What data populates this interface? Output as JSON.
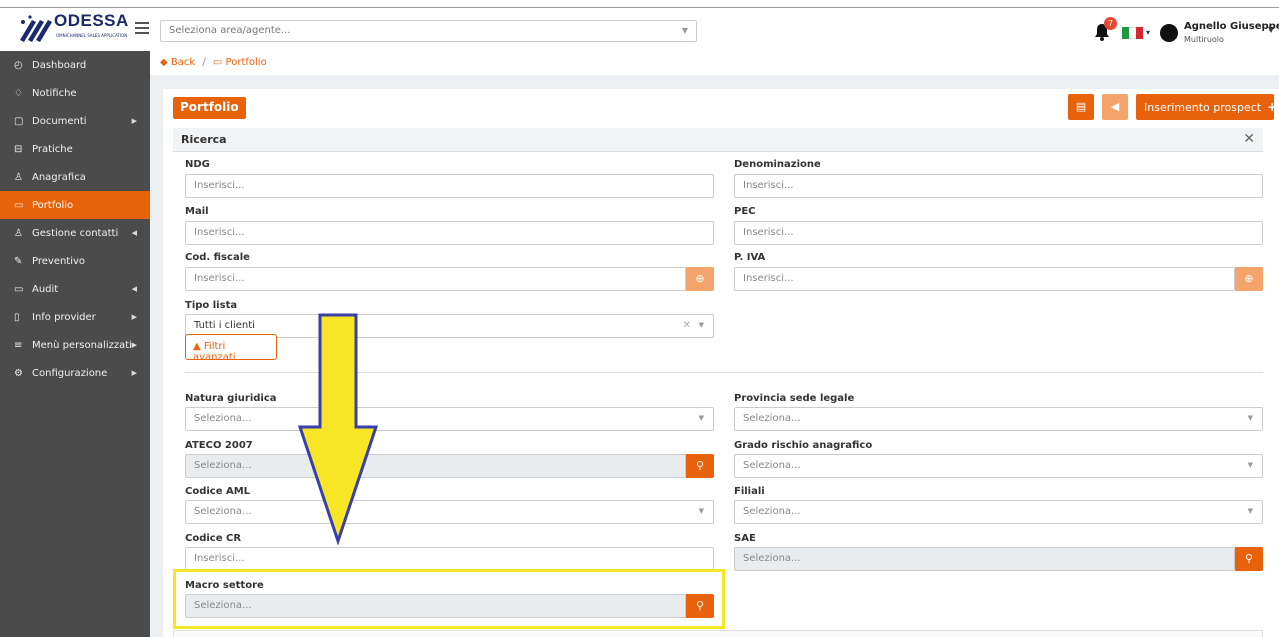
{
  "header": {
    "logo_text": "ODESSA",
    "logo_sub": "OMNICHANNEL SALES APPLICATION",
    "area_placeholder": "Seleziona area/agente...",
    "notification_count": "7",
    "user_name": "Agnello Giuseppe",
    "user_role": "Multiruolo"
  },
  "sidebar": {
    "items": [
      {
        "label": "Dashboard",
        "icon": "dashboard-icon"
      },
      {
        "label": "Notifiche",
        "icon": "bell-icon"
      },
      {
        "label": "Documenti",
        "icon": "documents-icon"
      },
      {
        "label": "Pratiche",
        "icon": "folder-icon"
      },
      {
        "label": "Anagrafica",
        "icon": "user-icon"
      },
      {
        "label": "Portfolio",
        "icon": "folder-icon"
      },
      {
        "label": "Gestione contatti",
        "icon": "users-icon"
      },
      {
        "label": "Preventivo",
        "icon": "edit-icon"
      },
      {
        "label": "Audit",
        "icon": "monitor-icon"
      },
      {
        "label": "Info provider",
        "icon": "file-icon"
      },
      {
        "label": "Menù personalizzati",
        "icon": "menu-icon"
      },
      {
        "label": "Configurazione",
        "icon": "gear-icon"
      }
    ]
  },
  "breadcrumb": {
    "back": "Back",
    "current": "Portfolio"
  },
  "page": {
    "title": "Portfolio",
    "add_button": "Inserimento prospect"
  },
  "search": {
    "title": "Ricerca",
    "filters_button": "Filtri avanzati",
    "fields": {
      "ndg": {
        "label": "NDG",
        "placeholder": "Inserisci..."
      },
      "denominazione": {
        "label": "Denominazione",
        "placeholder": "Inserisci..."
      },
      "mail": {
        "label": "Mail",
        "placeholder": "Inserisci..."
      },
      "pec": {
        "label": "PEC",
        "placeholder": "Inserisci..."
      },
      "cod_fiscale": {
        "label": "Cod. fiscale",
        "placeholder": "Inserisci..."
      },
      "piva": {
        "label": "P. IVA",
        "placeholder": "Inserisci..."
      },
      "tipo_lista": {
        "label": "Tipo lista",
        "value": "Tutti i clienti"
      },
      "natura_giuridica": {
        "label": "Natura giuridica",
        "placeholder": "Seleziona..."
      },
      "provincia": {
        "label": "Provincia sede legale",
        "placeholder": "Seleziona..."
      },
      "ateco": {
        "label": "ATECO 2007",
        "placeholder": "Seleziona..."
      },
      "grado_rischio": {
        "label": "Grado rischio anagrafico",
        "placeholder": "Seleziona..."
      },
      "codice_aml": {
        "label": "Codice AML",
        "placeholder": "Seleziona..."
      },
      "filiali": {
        "label": "Filiali",
        "placeholder": "Seleziona..."
      },
      "codice_cr": {
        "label": "Codice CR",
        "placeholder": "Inserisci..."
      },
      "sae": {
        "label": "SAE",
        "placeholder": "Seleziona..."
      },
      "macro_settore": {
        "label": "Macro settore",
        "placeholder": "Seleziona..."
      }
    }
  },
  "colors": {
    "accent": "#e8620c",
    "sidebar_bg": "#4b4b4b",
    "highlight_arrow": "#f7e626",
    "arrow_outline": "#3a3fa8"
  }
}
